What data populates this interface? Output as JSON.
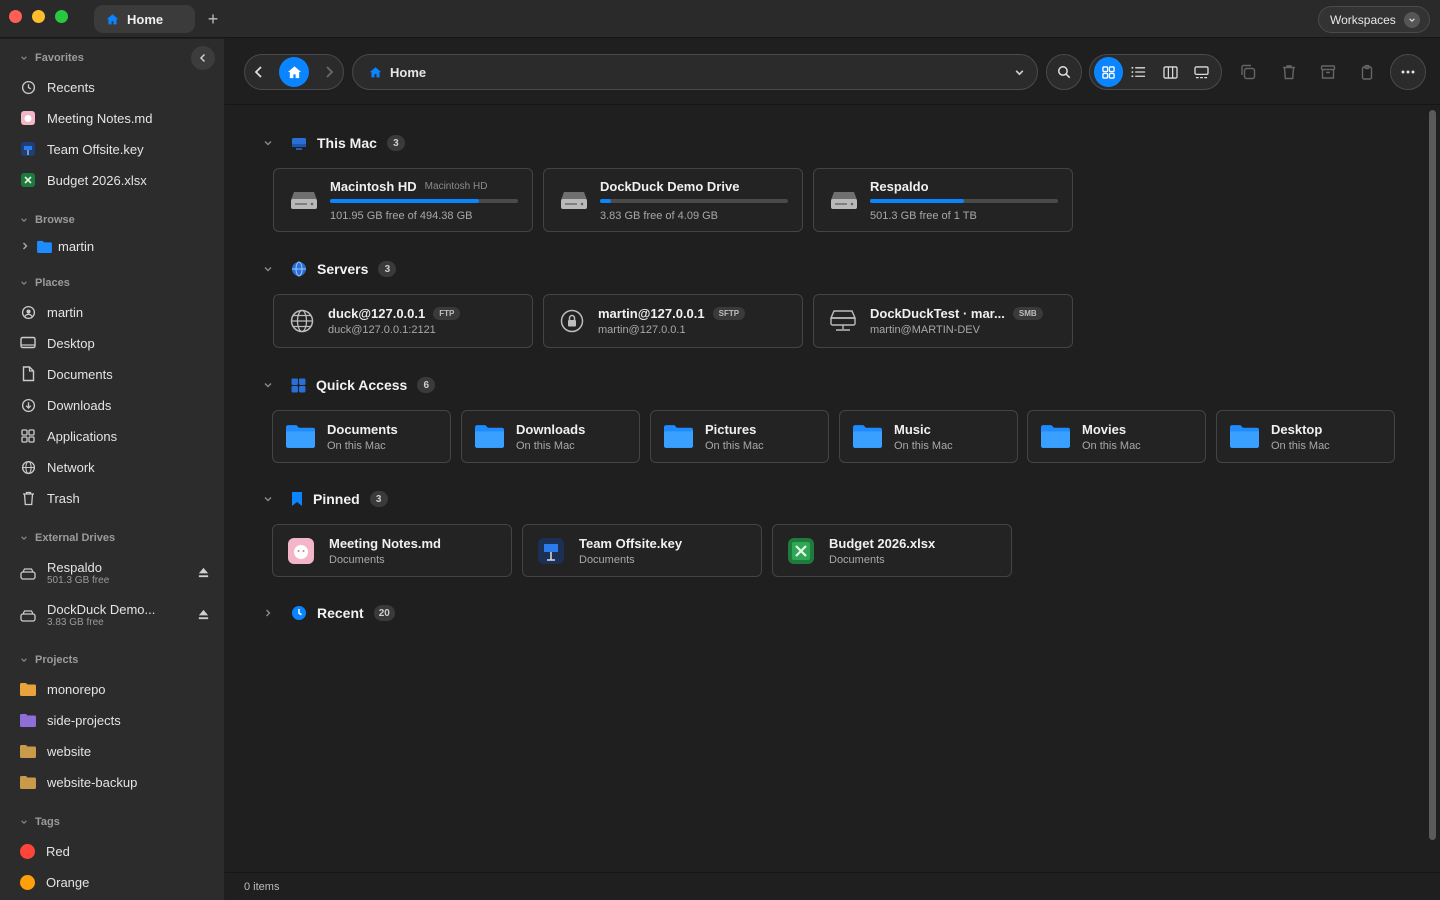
{
  "titlebar": {
    "tab_label": "Home",
    "new_tab": "+",
    "workspaces_label": "Workspaces"
  },
  "sidebar": {
    "favorites": {
      "title": "Favorites",
      "items": [
        {
          "label": "Recents",
          "icon": "clock-icon"
        },
        {
          "label": "Meeting Notes.md",
          "icon": "markdown-file-icon"
        },
        {
          "label": "Team Offsite.key",
          "icon": "keynote-file-icon"
        },
        {
          "label": "Budget 2026.xlsx",
          "icon": "excel-file-icon"
        }
      ]
    },
    "browse": {
      "title": "Browse",
      "items": [
        {
          "label": "martin",
          "icon": "folder-icon"
        }
      ]
    },
    "places": {
      "title": "Places",
      "items": [
        {
          "label": "martin",
          "icon": "user-icon"
        },
        {
          "label": "Desktop",
          "icon": "desktop-icon"
        },
        {
          "label": "Documents",
          "icon": "document-icon"
        },
        {
          "label": "Downloads",
          "icon": "download-icon"
        },
        {
          "label": "Applications",
          "icon": "applications-icon"
        },
        {
          "label": "Network",
          "icon": "globe-icon"
        },
        {
          "label": "Trash",
          "icon": "trash-icon"
        }
      ]
    },
    "external_drives": {
      "title": "External Drives",
      "items": [
        {
          "label": "Respaldo",
          "sub": "501.3 GB free"
        },
        {
          "label": "DockDuck Demo...",
          "sub": "3.83 GB free"
        }
      ]
    },
    "projects": {
      "title": "Projects",
      "items": [
        {
          "label": "monorepo",
          "color": "#e8a33c"
        },
        {
          "label": "side-projects",
          "color": "#8e6fd8"
        },
        {
          "label": "website",
          "color": "#c99a4a"
        },
        {
          "label": "website-backup",
          "color": "#c99a4a"
        }
      ]
    },
    "tags": {
      "title": "Tags",
      "items": [
        {
          "label": "Red",
          "color": "#ff453a"
        },
        {
          "label": "Orange",
          "color": "#ff9f0a"
        }
      ]
    }
  },
  "toolbar": {
    "path_label": "Home"
  },
  "sections": {
    "this_mac": {
      "title": "This Mac",
      "count": "3",
      "drives": [
        {
          "name": "Macintosh HD",
          "tag": "Macintosh HD",
          "free": "101.95 GB free of 494.38 GB",
          "used_fraction": 0.79
        },
        {
          "name": "DockDuck Demo Drive",
          "tag": "",
          "free": "3.83 GB free of 4.09 GB",
          "used_fraction": 0.06
        },
        {
          "name": "Respaldo",
          "tag": "",
          "free": "501.3 GB free of 1 TB",
          "used_fraction": 0.5
        }
      ]
    },
    "servers": {
      "title": "Servers",
      "count": "3",
      "items": [
        {
          "name": "duck@127.0.0.1",
          "protocol": "FTP",
          "address": "duck@127.0.0.1:2121"
        },
        {
          "name": "martin@127.0.0.1",
          "protocol": "SFTP",
          "address": "martin@127.0.0.1"
        },
        {
          "name": "DockDuckTest · mar...",
          "protocol": "SMB",
          "address": "martin@MARTIN-DEV"
        }
      ]
    },
    "quick_access": {
      "title": "Quick Access",
      "count": "6",
      "items": [
        {
          "name": "Documents",
          "sub": "On this Mac"
        },
        {
          "name": "Downloads",
          "sub": "On this Mac"
        },
        {
          "name": "Pictures",
          "sub": "On this Mac"
        },
        {
          "name": "Music",
          "sub": "On this Mac"
        },
        {
          "name": "Movies",
          "sub": "On this Mac"
        },
        {
          "name": "Desktop",
          "sub": "On this Mac"
        }
      ]
    },
    "pinned": {
      "title": "Pinned",
      "count": "3",
      "items": [
        {
          "name": "Meeting Notes.md",
          "sub": "Documents"
        },
        {
          "name": "Team Offsite.key",
          "sub": "Documents"
        },
        {
          "name": "Budget 2026.xlsx",
          "sub": "Documents"
        }
      ]
    },
    "recent": {
      "title": "Recent",
      "count": "20"
    }
  },
  "status": {
    "items": "0 items"
  },
  "colors": {
    "accent": "#0a84ff",
    "folder": "#1e8bff"
  }
}
